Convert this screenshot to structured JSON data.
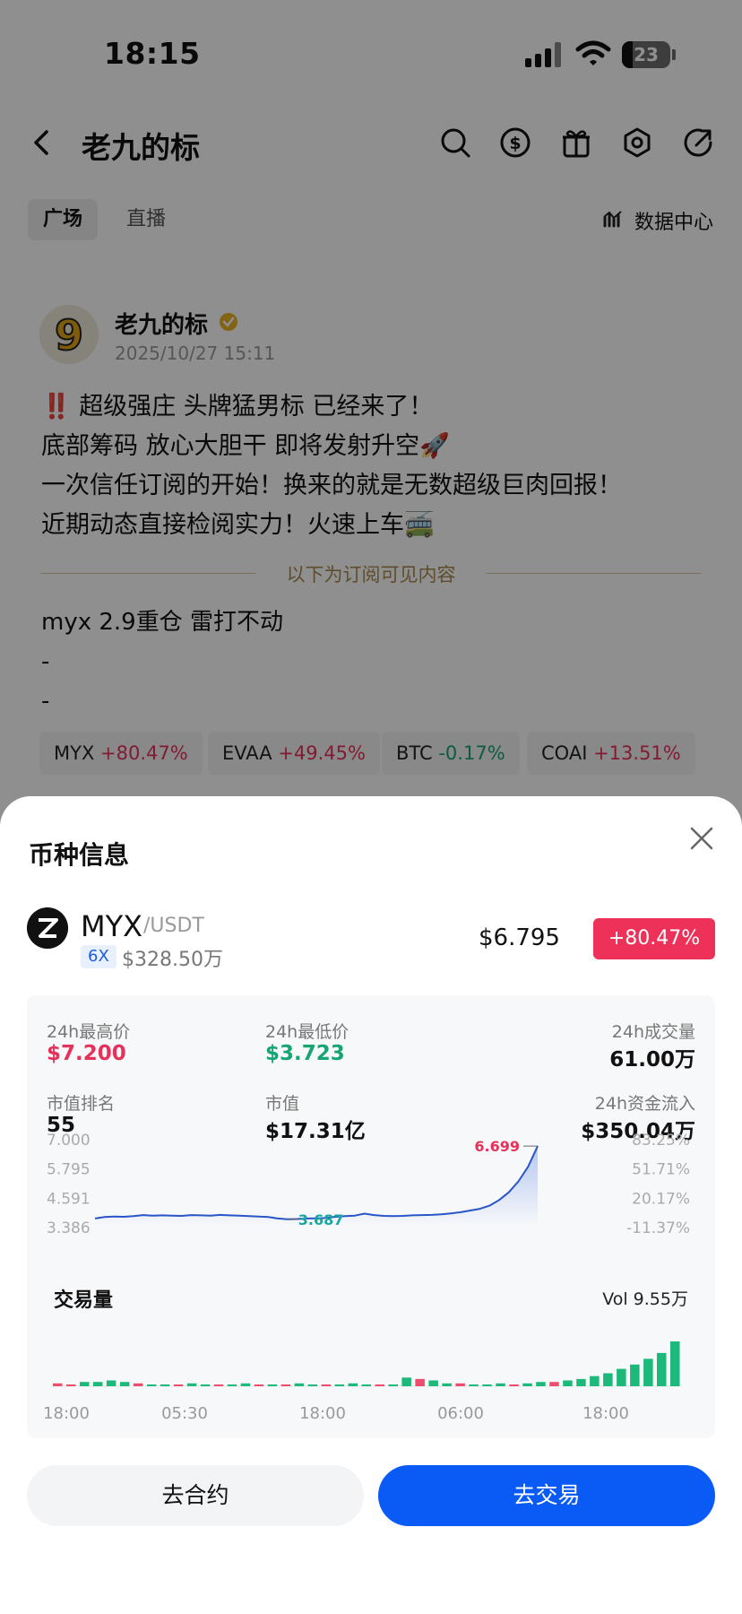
{
  "status_bar": {
    "time": "18:15",
    "battery": "23"
  },
  "nav": {
    "title": "老九的标",
    "icons": [
      "back-icon",
      "search-icon",
      "dollar-icon",
      "gift-icon",
      "settings-icon",
      "share-icon"
    ]
  },
  "tabs": [
    {
      "label": "广场",
      "active": true
    },
    {
      "label": "直播",
      "active": false
    }
  ],
  "data_center": {
    "label": "数据中心",
    "icon": "chart-icon"
  },
  "post": {
    "author": "老九的标",
    "time": "2025/10/27 15:11",
    "lines": [
      "‼️ 超级强庄 头牌猛男标 已经来了！",
      "底部筹码 放心大胆干 即将发射升空🚀",
      "一次信任订阅的开始！换来的就是无数超级巨肉回报！",
      "近期动态直接检阅实力！火速上车🚎"
    ],
    "divider": "以下为订阅可见内容",
    "sub_lines": [
      "myx 2.9重仓 雷打不动",
      "-",
      "-"
    ],
    "tickers": [
      {
        "symbol": "MYX",
        "change": "+80.47%",
        "dir": "up"
      },
      {
        "symbol": "EVAA",
        "change": "+49.45%",
        "dir": "up"
      },
      {
        "symbol": "BTC",
        "change": "-0.17%",
        "dir": "down"
      },
      {
        "symbol": "COAI",
        "change": "+13.51%",
        "dir": "up"
      }
    ]
  },
  "sheet": {
    "title": "币种信息",
    "coin": {
      "symbol": "MYX",
      "quote": "/USDT",
      "leverage": "6X",
      "volume_usd": "$328.50万",
      "price": "$6.795",
      "change": "+80.47%"
    },
    "stats": {
      "high_label": "24h最高价",
      "high_value": "$7.200",
      "low_label": "24h最低价",
      "low_value": "$3.723",
      "vol_label": "24h成交量",
      "vol_value": "61.00万",
      "rank_label": "市值排名",
      "rank_value": "55",
      "mcap_label": "市值",
      "mcap_value": "$17.31亿",
      "flow_label": "24h资金流入",
      "flow_value": "$350.04万"
    },
    "volume_title": "交易量",
    "volume_total": "Vol 9.55万",
    "buttons": {
      "futures": "去合约",
      "trade": "去交易"
    }
  },
  "chart_data": {
    "type": "line",
    "y_ticks_left": [
      "7.000",
      "5.795",
      "4.591",
      "3.386"
    ],
    "y_ticks_right": [
      "83.25%",
      "51.71%",
      "20.17%",
      "-11.37%"
    ],
    "ylim": [
      3.386,
      7.0
    ],
    "max_label": "6.699",
    "min_label": "3.687",
    "x_ticks": [
      "18:00",
      "05:30",
      "18:00",
      "06:00",
      "18:00"
    ],
    "series": [
      {
        "values": [
          3.72,
          3.78,
          3.8,
          3.79,
          3.82,
          3.86,
          3.84,
          3.85,
          3.84,
          3.83,
          3.86,
          3.85,
          3.84,
          3.87,
          3.85,
          3.84,
          3.82,
          3.8,
          3.78,
          3.72,
          3.69,
          3.7,
          3.72,
          3.73,
          3.74,
          3.79,
          3.82,
          3.84,
          3.92,
          3.86,
          3.83,
          3.82,
          3.83,
          3.85,
          3.86,
          3.87,
          3.89,
          3.93,
          3.98,
          4.05,
          4.12,
          4.25,
          4.48,
          4.8,
          5.25,
          5.85,
          6.7
        ]
      }
    ],
    "volume": {
      "bars": [
        {
          "v": 2,
          "up": false
        },
        {
          "v": 1,
          "up": false
        },
        {
          "v": 3,
          "up": true
        },
        {
          "v": 3,
          "up": true
        },
        {
          "v": 4,
          "up": true
        },
        {
          "v": 3,
          "up": true
        },
        {
          "v": 2,
          "up": false
        },
        {
          "v": 1,
          "up": true
        },
        {
          "v": 1,
          "up": true
        },
        {
          "v": 1,
          "up": false
        },
        {
          "v": 2,
          "up": true
        },
        {
          "v": 1,
          "up": true
        },
        {
          "v": 1,
          "up": false
        },
        {
          "v": 1,
          "up": true
        },
        {
          "v": 2,
          "up": true
        },
        {
          "v": 1,
          "up": false
        },
        {
          "v": 1,
          "up": true
        },
        {
          "v": 1,
          "up": false
        },
        {
          "v": 2,
          "up": true
        },
        {
          "v": 1,
          "up": true
        },
        {
          "v": 1,
          "up": false
        },
        {
          "v": 1,
          "up": true
        },
        {
          "v": 2,
          "up": true
        },
        {
          "v": 1,
          "up": true
        },
        {
          "v": 1,
          "up": false
        },
        {
          "v": 1,
          "up": true
        },
        {
          "v": 6,
          "up": true
        },
        {
          "v": 5,
          "up": false
        },
        {
          "v": 4,
          "up": true
        },
        {
          "v": 2,
          "up": true
        },
        {
          "v": 2,
          "up": false
        },
        {
          "v": 1,
          "up": true
        },
        {
          "v": 1,
          "up": true
        },
        {
          "v": 2,
          "up": true
        },
        {
          "v": 1,
          "up": false
        },
        {
          "v": 2,
          "up": true
        },
        {
          "v": 3,
          "up": true
        },
        {
          "v": 3,
          "up": false
        },
        {
          "v": 4,
          "up": true
        },
        {
          "v": 5,
          "up": true
        },
        {
          "v": 7,
          "up": true
        },
        {
          "v": 9,
          "up": true
        },
        {
          "v": 12,
          "up": true
        },
        {
          "v": 15,
          "up": true
        },
        {
          "v": 19,
          "up": true
        },
        {
          "v": 23,
          "up": true
        },
        {
          "v": 31,
          "up": true
        }
      ]
    }
  }
}
